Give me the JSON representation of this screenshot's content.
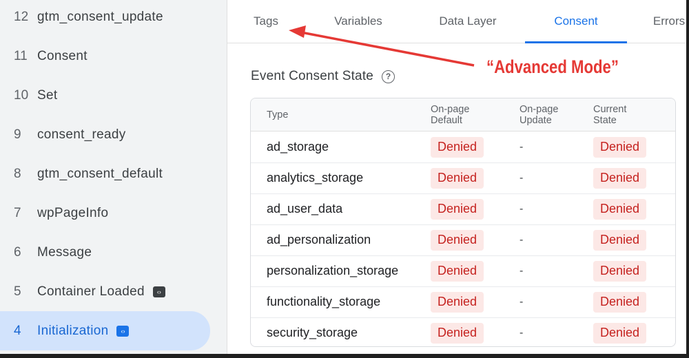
{
  "sidebar": {
    "events": [
      {
        "num": "12",
        "name": "gtm_consent_update",
        "badge": false,
        "active": false
      },
      {
        "num": "11",
        "name": "Consent",
        "badge": false,
        "active": false
      },
      {
        "num": "10",
        "name": "Set",
        "badge": false,
        "active": false
      },
      {
        "num": "9",
        "name": "consent_ready",
        "badge": false,
        "active": false
      },
      {
        "num": "8",
        "name": "gtm_consent_default",
        "badge": false,
        "active": false
      },
      {
        "num": "7",
        "name": "wpPageInfo",
        "badge": false,
        "active": false
      },
      {
        "num": "6",
        "name": "Message",
        "badge": false,
        "active": false
      },
      {
        "num": "5",
        "name": "Container Loaded",
        "badge": true,
        "active": false
      },
      {
        "num": "4",
        "name": "Initialization",
        "badge": true,
        "active": true
      }
    ],
    "badge_glyph": "‹›"
  },
  "tabs": [
    {
      "label": "Tags",
      "active": false
    },
    {
      "label": "Variables",
      "active": false
    },
    {
      "label": "Data Layer",
      "active": false
    },
    {
      "label": "Consent",
      "active": true
    },
    {
      "label": "Errors",
      "active": false
    }
  ],
  "section": {
    "title": "Event Consent State",
    "help_icon": "?"
  },
  "table": {
    "headers": {
      "type": "Type",
      "default_line1": "On-page",
      "default_line2": "Default",
      "update_line1": "On-page",
      "update_line2": "Update",
      "current_line1": "Current",
      "current_line2": "State"
    },
    "rows": [
      {
        "type": "ad_storage",
        "default": "Denied",
        "update": "-",
        "current": "Denied"
      },
      {
        "type": "analytics_storage",
        "default": "Denied",
        "update": "-",
        "current": "Denied"
      },
      {
        "type": "ad_user_data",
        "default": "Denied",
        "update": "-",
        "current": "Denied"
      },
      {
        "type": "ad_personalization",
        "default": "Denied",
        "update": "-",
        "current": "Denied"
      },
      {
        "type": "personalization_storage",
        "default": "Denied",
        "update": "-",
        "current": "Denied"
      },
      {
        "type": "functionality_storage",
        "default": "Denied",
        "update": "-",
        "current": "Denied"
      },
      {
        "type": "security_storage",
        "default": "Denied",
        "update": "-",
        "current": "Denied"
      }
    ]
  },
  "annotation": {
    "text": "“Advanced Mode”",
    "color": "#e53935"
  },
  "colors": {
    "accent": "#1a73e8",
    "denied_bg": "#fce8e6",
    "denied_text": "#c5221f",
    "sidebar_active": "#d2e3fc"
  }
}
